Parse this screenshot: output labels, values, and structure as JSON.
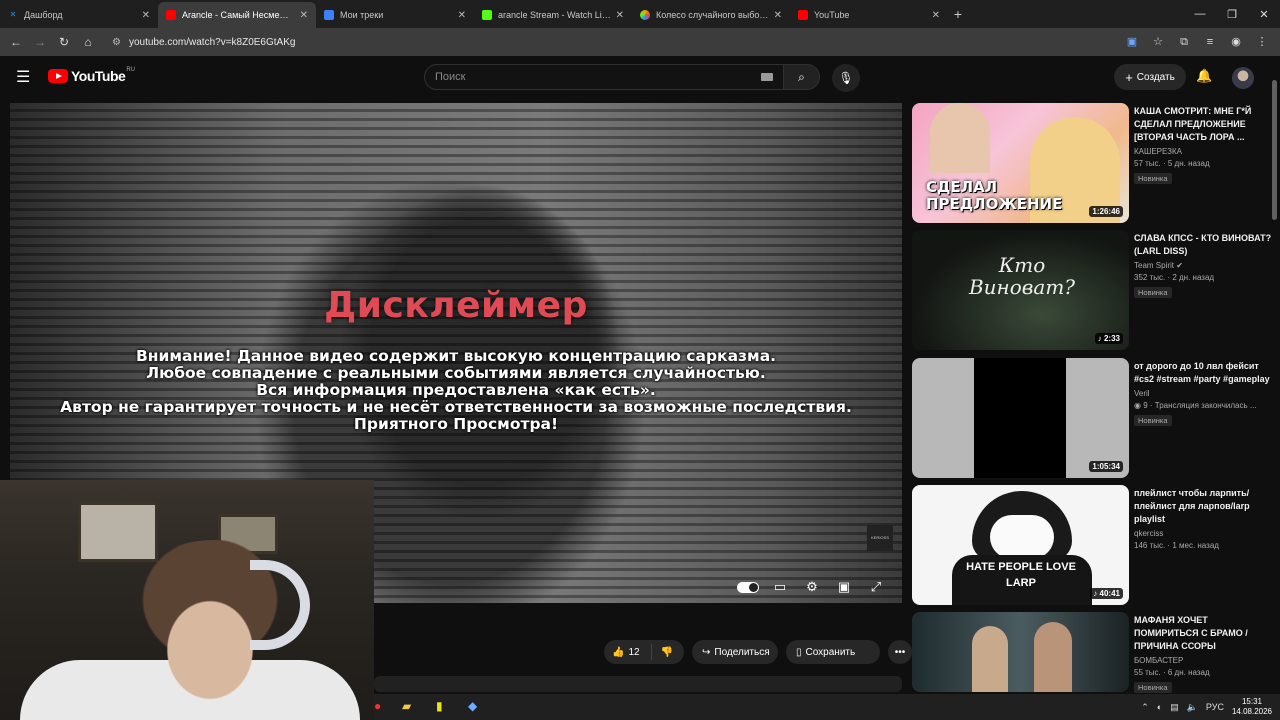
{
  "browser": {
    "tabs": [
      {
        "label": "Дашборд",
        "icon": "x-icon",
        "color": "#1e90ff"
      },
      {
        "label": "Arancle - Самый Несмешной",
        "icon": "youtube-icon",
        "color": "#ff0000",
        "active": true
      },
      {
        "label": "Мои треки",
        "icon": "app-icon",
        "color": "#3b82f6"
      },
      {
        "label": "arancle Stream - Watch Live on",
        "icon": "kick-icon",
        "color": "#53fc18"
      },
      {
        "label": "Колесо случайного выбора –",
        "icon": "wheel-icon",
        "color": "#e6a700"
      },
      {
        "label": "YouTube",
        "icon": "youtube-icon",
        "color": "#ff0000"
      }
    ],
    "url": "youtube.com/watch?v=k8Z0E6GtAKg"
  },
  "youtube": {
    "logo_text": "YouTube",
    "logo_region": "RU",
    "search_placeholder": "Поиск",
    "create_label": "Создать"
  },
  "video": {
    "title": "Дисклеймер",
    "lines": [
      "Внимание! Данное видео содержит высокую концентрацию сарказма.",
      "Любое совпадение с реальными событиями является случайностью.",
      "Вся информация предоставлена «как есть».",
      "Автор не гарантирует точность и не несёт ответственности за возможные последствия.",
      "Приятного Просмотра!"
    ],
    "watermark": "KERIOSS"
  },
  "actions": {
    "likes": "12",
    "share_label": "Поделиться",
    "save_label": "Сохранить"
  },
  "taskbar": {
    "lang": "РУС",
    "time": "15:31",
    "date": "14.08.2026"
  },
  "recommendations": [
    {
      "title": "КАША СМОТРИТ: МНЕ Г*Й СДЕЛАЛ ПРЕДЛОЖЕНИЕ [ВТОРАЯ ЧАСТЬ ЛОРА ...",
      "channel": "КАШЕРЕЗКА",
      "meta": "57 тыс. · 5 дн. назад",
      "badge": "Новинка",
      "duration": "1:26:46",
      "thumb_text": "СДЕЛАЛ ПРЕДЛОЖЕНИЕ"
    },
    {
      "title": "СЛАВА КПСС - КТО ВИНОВАТ? (LARL DISS)",
      "channel": "Team Spirit ✔",
      "meta": "352 тыс. · 2 дн. назад",
      "badge": "Новинка",
      "duration": "2:33",
      "thumb_text": "Кто Виноват?"
    },
    {
      "title": "от дорого до 10 лвл фейсит #cs2 #stream #party #gameplay",
      "channel": "Veril",
      "meta": "9 · Трансляция закончилась ...",
      "badge": "Новинка",
      "duration": "1:05:34",
      "thumb_text": ""
    },
    {
      "title": "плейлист чтобы ларпить/ плейлист для ларпов/larp playlist",
      "channel": "qkerciss",
      "meta": "146 тыс. · 1 мес. назад",
      "badge": "",
      "duration": "40:41",
      "thumb_text": "HATE PEOPLE LOVE LARP"
    },
    {
      "title": "МАФАНЯ ХОЧЕТ ПОМИРИТЬСЯ С БРАМО / ПРИЧИНА ССОРЫ",
      "channel": "БОМБАСТЕР",
      "meta": "55 тыс. · 6 дн. назад",
      "badge": "Новинка",
      "duration": "",
      "thumb_text": ""
    }
  ]
}
